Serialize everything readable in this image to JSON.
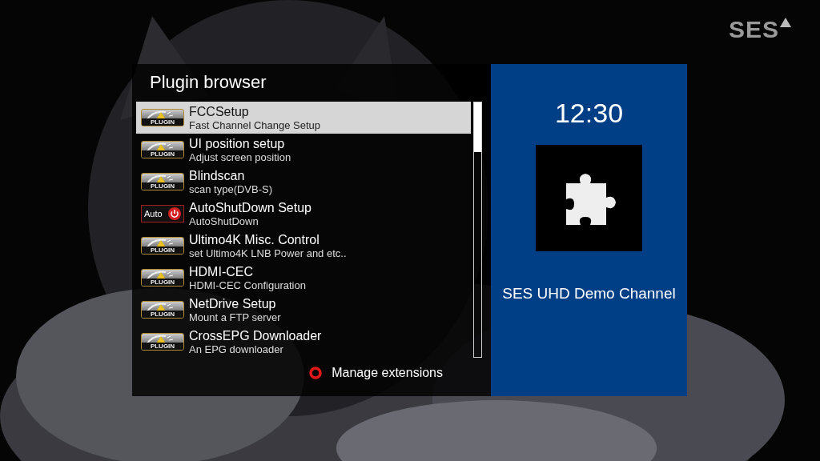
{
  "logo": {
    "text": "SES"
  },
  "plugin_browser": {
    "title": "Plugin browser",
    "items": [
      {
        "kind": "plugin",
        "icon_label": "PLUGIN",
        "name": "FCCSetup",
        "description": "Fast Channel Change Setup",
        "selected": true
      },
      {
        "kind": "plugin",
        "icon_label": "PLUGIN",
        "name": "UI position setup",
        "description": "Adjust screen position",
        "selected": false
      },
      {
        "kind": "plugin",
        "icon_label": "PLUGIN",
        "name": "Blindscan",
        "description": "scan type(DVB-S)",
        "selected": false
      },
      {
        "kind": "power",
        "icon_label": "Auto",
        "name": "AutoShutDown Setup",
        "description": "AutoShutDown",
        "selected": false
      },
      {
        "kind": "plugin",
        "icon_label": "PLUGIN",
        "name": "Ultimo4K Misc. Control",
        "description": "set Ultimo4K LNB Power and etc..",
        "selected": false
      },
      {
        "kind": "plugin",
        "icon_label": "PLUGIN",
        "name": "HDMI-CEC",
        "description": "HDMI-CEC Configuration",
        "selected": false
      },
      {
        "kind": "plugin",
        "icon_label": "PLUGIN",
        "name": "NetDrive Setup",
        "description": "Mount a FTP server",
        "selected": false
      },
      {
        "kind": "plugin",
        "icon_label": "PLUGIN",
        "name": "CrossEPG Downloader",
        "description": "An EPG downloader",
        "selected": false
      }
    ],
    "red_button": {
      "label": "Manage extensions"
    }
  },
  "info_panel": {
    "time": "12:30",
    "channel": "SES UHD Demo Channel"
  }
}
